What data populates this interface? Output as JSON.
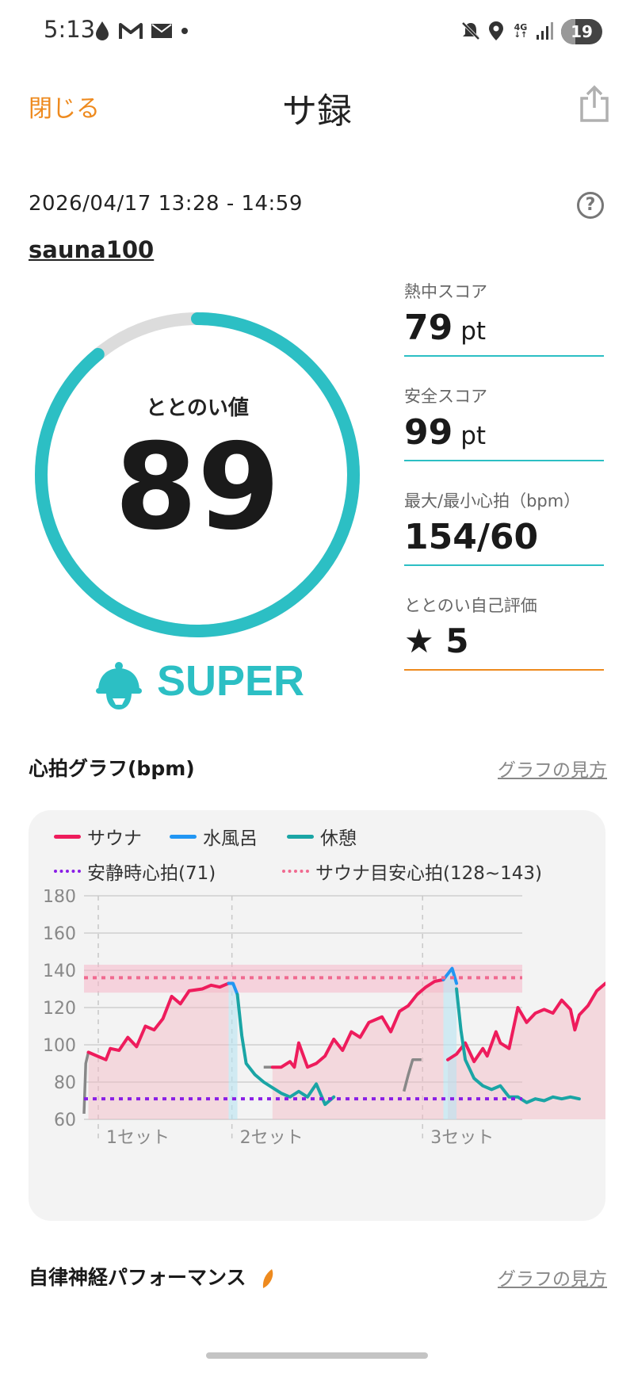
{
  "status_bar": {
    "time": "5:13",
    "left_icons": [
      "drop-icon",
      "gmail-icon",
      "mail-icon",
      "dot-icon"
    ],
    "right_icons": [
      "mute-icon",
      "location-icon",
      "4g-icon",
      "signal-icon"
    ],
    "network": "4G",
    "battery": "19"
  },
  "header": {
    "close_label": "閉じる",
    "title": "サ録",
    "share_icon": "share-icon"
  },
  "session": {
    "datetime": "2026/04/17 13:28 - 14:59",
    "facility": "sauna100",
    "help_icon": "help-icon"
  },
  "gauge": {
    "label": "ととのい値",
    "value": "89",
    "fraction": 0.89,
    "rating": "SUPER",
    "color": "#2cbfc4",
    "track_color": "#dcdcdc"
  },
  "scores": [
    {
      "label": "熱中スコア",
      "value": "79",
      "unit": "pt"
    },
    {
      "label": "安全スコア",
      "value": "99",
      "unit": "pt"
    },
    {
      "label": "最大/最小心拍（bpm）",
      "value": "154/60",
      "unit": ""
    },
    {
      "label": "ととのい自己評価",
      "value": "★ 5",
      "unit": ""
    }
  ],
  "hr_graph": {
    "title": "心拍グラフ(bpm)",
    "guide_link": "グラフの見方"
  },
  "anp": {
    "title": "自律神経パフォーマンス",
    "guide_link": "グラフの見方"
  },
  "chart_data": {
    "type": "line",
    "title": "心拍グラフ(bpm)",
    "ylim": [
      60,
      180
    ],
    "yticks": [
      "60",
      "80",
      "100",
      "120",
      "140",
      "160",
      "180"
    ],
    "set_labels": [
      "1セット",
      "2セット",
      "3セット"
    ],
    "legend": [
      {
        "name": "サウナ",
        "color": "#ee1c5c",
        "style": "solid"
      },
      {
        "name": "水風呂",
        "color": "#2196f3",
        "style": "solid"
      },
      {
        "name": "休憩",
        "color": "#1aa5a5",
        "style": "solid"
      },
      {
        "name": "安静時心拍(71)",
        "color": "#8a1ee6",
        "style": "dotted"
      },
      {
        "name": "サウナ目安心拍(128~143)",
        "color": "#f06a90",
        "style": "dotted"
      }
    ],
    "resting_hr": 71,
    "target_band": [
      128,
      143
    ],
    "target_line": 136,
    "x_range": [
      0,
      100
    ],
    "set_marks": [
      0,
      30.5,
      74
    ],
    "series": [
      {
        "name": "サウナ",
        "color": "#ee1c5c",
        "segments": [
          [
            [
              1,
              96
            ],
            [
              3,
              94
            ],
            [
              5,
              92
            ],
            [
              6,
              98
            ],
            [
              8,
              97
            ],
            [
              10,
              104
            ],
            [
              12,
              99
            ],
            [
              14,
              110
            ],
            [
              16,
              108
            ],
            [
              18,
              114
            ],
            [
              20,
              126
            ],
            [
              22,
              122
            ],
            [
              24,
              129
            ],
            [
              27,
              130
            ],
            [
              29,
              132
            ],
            [
              31,
              131
            ],
            [
              33,
              133
            ]
          ],
          [
            [
              43,
              88
            ],
            [
              45,
              88
            ],
            [
              47,
              91
            ],
            [
              48,
              88
            ],
            [
              49,
              101
            ],
            [
              51,
              88
            ],
            [
              53,
              90
            ],
            [
              55,
              94
            ],
            [
              57,
              103
            ],
            [
              59,
              97
            ],
            [
              61,
              107
            ],
            [
              63,
              104
            ],
            [
              65,
              112
            ],
            [
              68,
              115
            ],
            [
              70,
              107
            ],
            [
              72,
              118
            ],
            [
              74,
              121
            ],
            [
              76,
              127
            ],
            [
              78,
              131
            ],
            [
              80,
              134
            ],
            [
              82,
              135
            ]
          ],
          [
            [
              83,
              92
            ],
            [
              85,
              95
            ],
            [
              87,
              101
            ],
            [
              89,
              91
            ],
            [
              91,
              98
            ],
            [
              92,
              94
            ],
            [
              94,
              107
            ],
            [
              95,
              101
            ],
            [
              97,
              98
            ],
            [
              99,
              120
            ],
            [
              101,
              112
            ],
            [
              103,
              117
            ],
            [
              105,
              119
            ],
            [
              107,
              117
            ],
            [
              109,
              124
            ],
            [
              111,
              119
            ],
            [
              112,
              108
            ],
            [
              113,
              116
            ],
            [
              115,
              121
            ],
            [
              117,
              129
            ],
            [
              119,
              133
            ],
            [
              121,
              131
            ]
          ]
        ]
      },
      {
        "name": "水風呂",
        "color": "#2196f3",
        "segments": [
          [
            [
              33,
              133
            ],
            [
              34,
              133
            ],
            [
              35,
              127
            ]
          ],
          [
            [
              82,
              135
            ],
            [
              83,
              138
            ],
            [
              84,
              141
            ],
            [
              85,
              133
            ]
          ]
        ]
      },
      {
        "name": "休憩",
        "color": "#1aa5a5",
        "segments": [
          [
            [
              35,
              127
            ],
            [
              36,
              105
            ],
            [
              37,
              90
            ],
            [
              39,
              84
            ],
            [
              41,
              80
            ],
            [
              43,
              77
            ],
            [
              45,
              74
            ],
            [
              47,
              72
            ],
            [
              49,
              75
            ],
            [
              51,
              72
            ],
            [
              53,
              79
            ],
            [
              55,
              68
            ],
            [
              57,
              72
            ]
          ],
          [
            [
              85,
              130
            ],
            [
              86,
              108
            ],
            [
              87,
              92
            ],
            [
              89,
              82
            ],
            [
              91,
              78
            ],
            [
              93,
              76
            ],
            [
              95,
              78
            ],
            [
              97,
              72
            ],
            [
              99,
              72
            ],
            [
              101,
              69
            ],
            [
              103,
              71
            ],
            [
              105,
              70
            ],
            [
              107,
              72
            ],
            [
              109,
              71
            ],
            [
              111,
              72
            ],
            [
              113,
              71
            ]
          ]
        ]
      }
    ]
  }
}
